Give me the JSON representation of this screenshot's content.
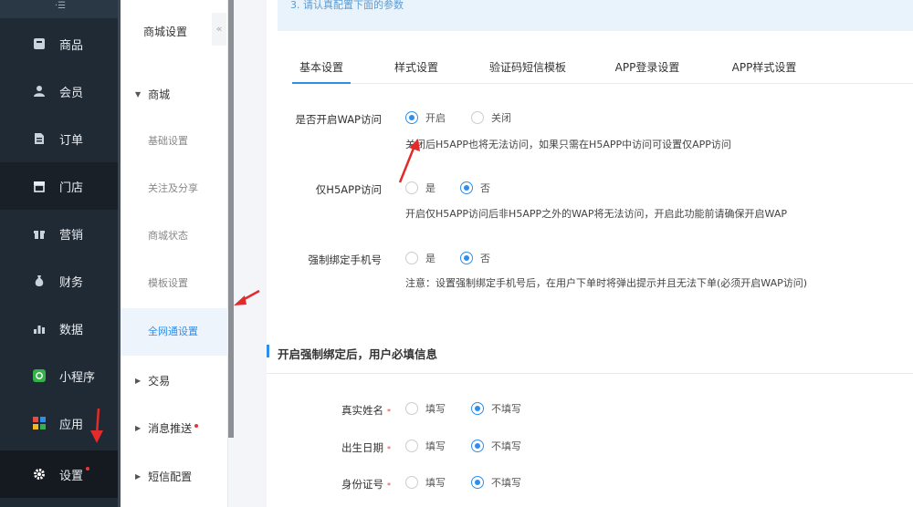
{
  "sidebar": {
    "top_mark": "·☰",
    "items": [
      {
        "label": "商品",
        "icon": "box-icon"
      },
      {
        "label": "会员",
        "icon": "user-icon"
      },
      {
        "label": "订单",
        "icon": "order-icon"
      },
      {
        "label": "门店",
        "icon": "store-icon"
      },
      {
        "label": "营销",
        "icon": "gift-icon"
      },
      {
        "label": "财务",
        "icon": "money-bag-icon"
      },
      {
        "label": "数据",
        "icon": "bar-chart-icon"
      },
      {
        "label": "小程序",
        "icon": "mini-program-icon"
      },
      {
        "label": "应用",
        "icon": "apps-grid-icon"
      },
      {
        "label": "设置",
        "icon": "gear-icon"
      }
    ]
  },
  "subnav": {
    "title": "商城设置",
    "collapse_glyph": "«",
    "group_store": "商城",
    "items": [
      "基础设置",
      "关注及分享",
      "商城状态",
      "模板设置",
      "全网通设置"
    ],
    "group_trade": "交易",
    "group_message": "消息推送",
    "group_sms": "短信配置"
  },
  "notice": "3. 请认真配置下面的参数",
  "tabs": [
    "基本设置",
    "样式设置",
    "验证码短信模板",
    "APP登录设置",
    "APP样式设置"
  ],
  "form": {
    "wap_label": "是否开启WAP访问",
    "wap_on": "开启",
    "wap_off": "关闭",
    "wap_help": "关闭后H5APP也将无法访问，如果只需在H5APP中访问可设置仅APP访问",
    "h5_label": "仅H5APP访问",
    "yes": "是",
    "no": "否",
    "h5_help": "开启仅H5APP访问后非H5APP之外的WAP将无法访问，开启此功能前请确保开启WAP",
    "bind_label": "强制绑定手机号",
    "bind_help": "注意：设置强制绑定手机号后，在用户下单时将弹出提示并且无法下单(必须开启WAP访问)"
  },
  "section_title": "开启强制绑定后，用户必填信息",
  "required_fields": {
    "fill": "填写",
    "no_fill": "不填写",
    "req_mark": "*",
    "rows": [
      "真实姓名",
      "出生日期",
      "身份证号"
    ]
  },
  "colors": {
    "accent": "#2f8ee8",
    "sidebar_bg": "#1f2a35",
    "arrow": "#e32b2b"
  }
}
